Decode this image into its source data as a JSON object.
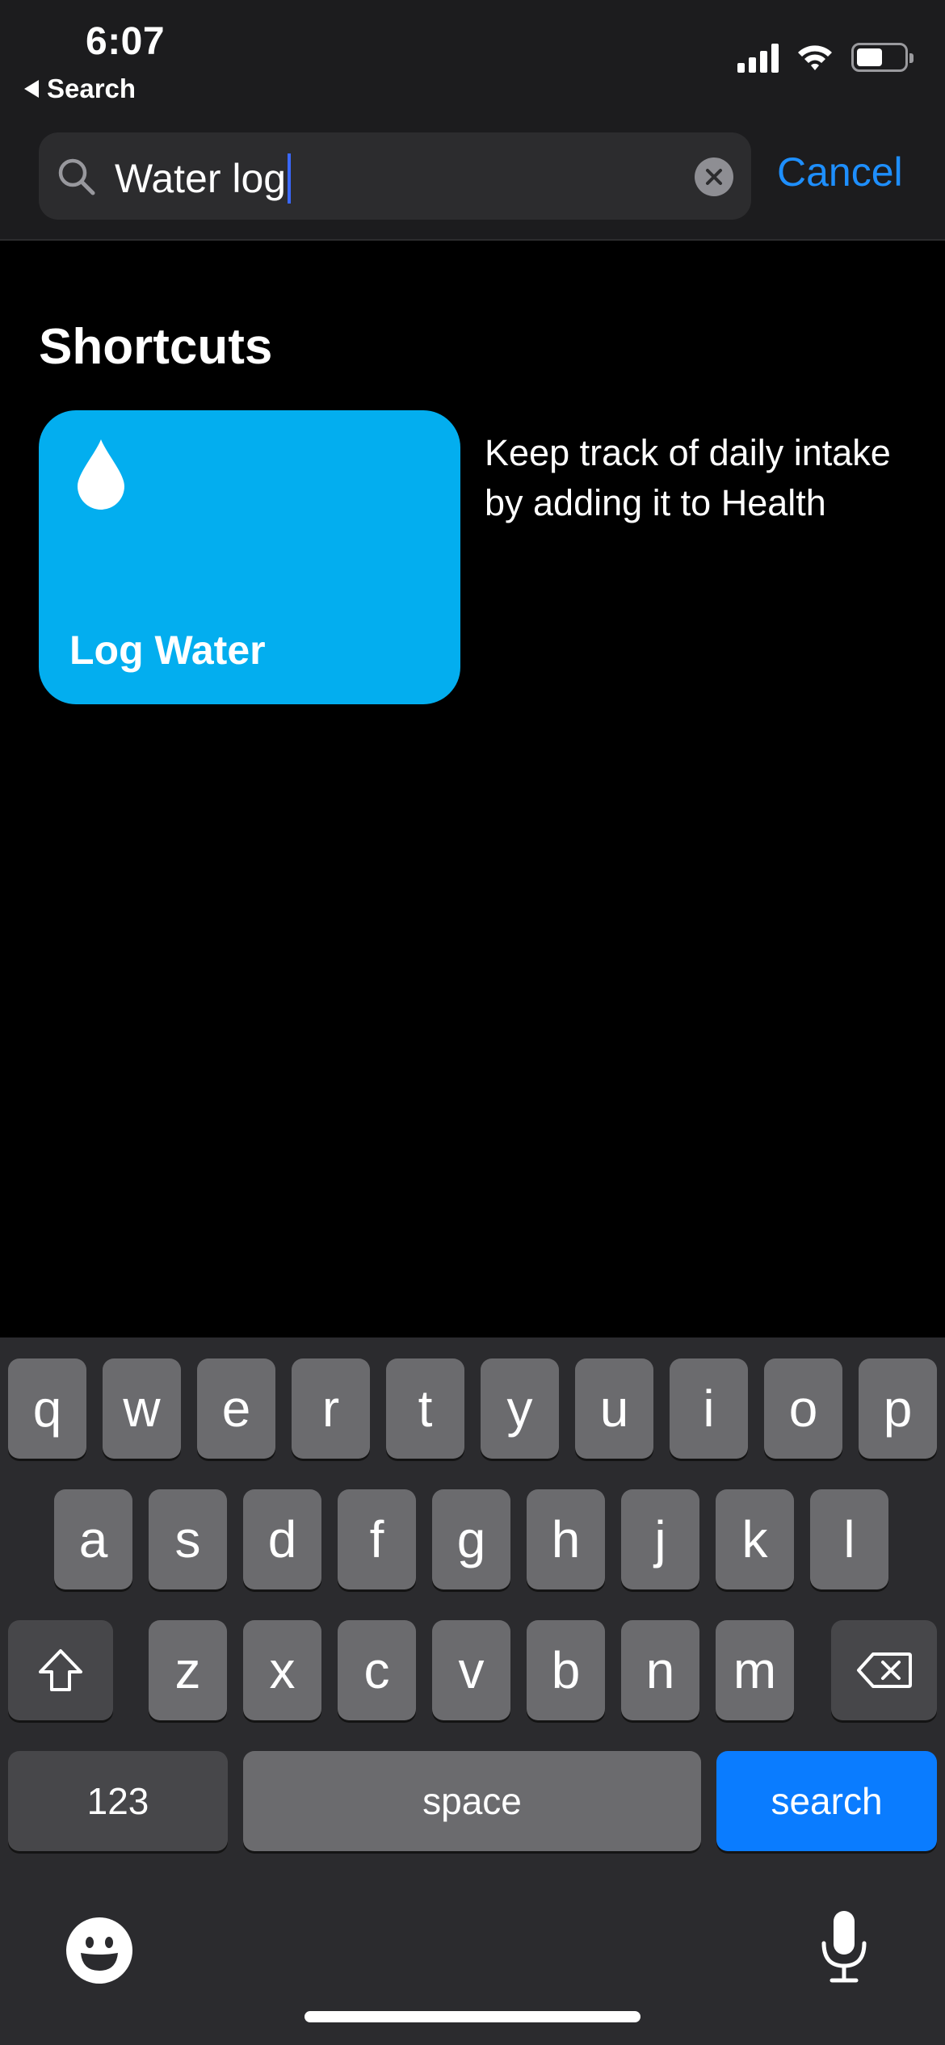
{
  "status_bar": {
    "time": "6:07",
    "back_label": "Search",
    "icons": [
      "cellular-signal-icon",
      "wifi-icon",
      "battery-icon"
    ],
    "battery_level": 0.55
  },
  "search": {
    "query": "Water log",
    "cancel_label": "Cancel"
  },
  "results": {
    "section_title": "Shortcuts",
    "shortcut": {
      "name": "Log Water",
      "description": "Keep track of daily intake by adding it to Health",
      "icon": "water-drop-icon",
      "color": "#03aeef"
    }
  },
  "keyboard": {
    "row1": [
      "q",
      "w",
      "e",
      "r",
      "t",
      "y",
      "u",
      "i",
      "o",
      "p"
    ],
    "row2": [
      "a",
      "s",
      "d",
      "f",
      "g",
      "h",
      "j",
      "k",
      "l"
    ],
    "row3": [
      "z",
      "x",
      "c",
      "v",
      "b",
      "n",
      "m"
    ],
    "numbers_label": "123",
    "space_label": "space",
    "search_label": "search",
    "icons": [
      "shift-icon",
      "delete-icon",
      "emoji-icon",
      "microphone-icon"
    ]
  },
  "colors": {
    "accent": "#1e8fff",
    "search_key": "#0a7cff",
    "header_bg": "#1c1c1e",
    "keyboard_bg": "#2b2b2e"
  }
}
